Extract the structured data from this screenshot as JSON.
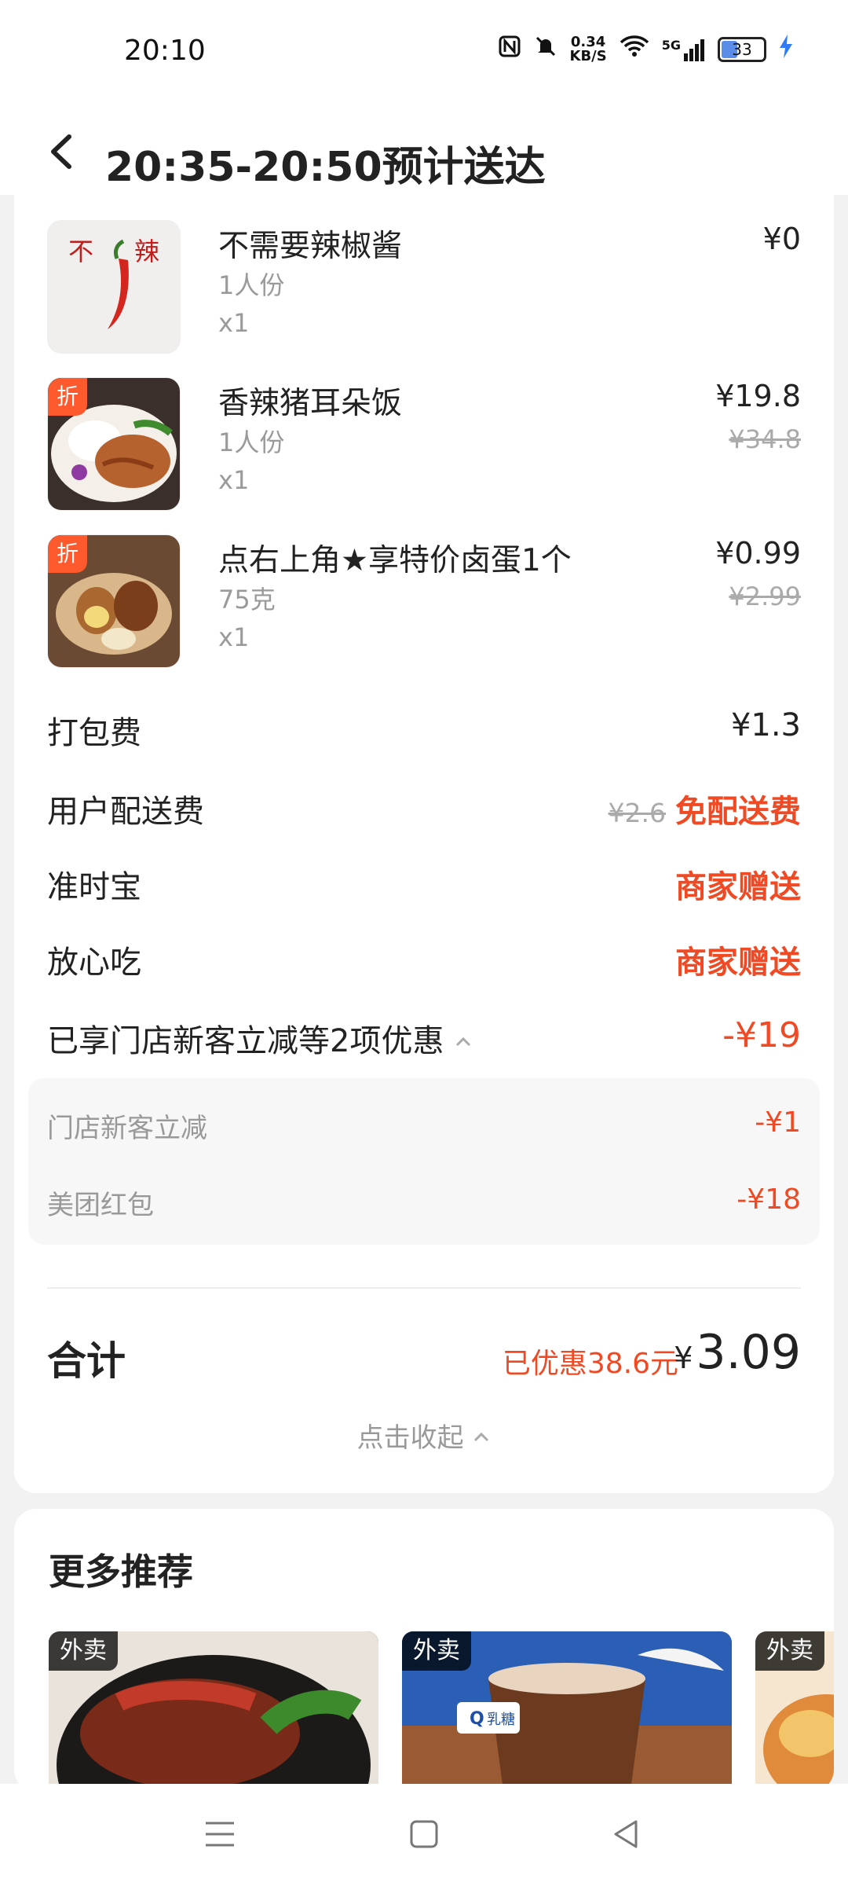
{
  "status": {
    "time": "20:10",
    "net_speed_value": "0.34",
    "net_speed_unit": "KB/S",
    "network": "5G",
    "battery": "33"
  },
  "header": {
    "title": "20:35-20:50预计送达"
  },
  "items": [
    {
      "name": "不需要辣椒酱",
      "spec": "1人份",
      "qty": "x1",
      "price": "¥0",
      "original_price": "",
      "discount_tag": "",
      "thumb_text": "不 辣"
    },
    {
      "name": "香辣猪耳朵饭",
      "spec": "1人份",
      "qty": "x1",
      "price": "¥19.8",
      "original_price": "¥34.8",
      "discount_tag": "折"
    },
    {
      "name": "点右上角★享特价卤蛋1个",
      "spec": "75克",
      "qty": "x1",
      "price": "¥0.99",
      "original_price": "¥2.99",
      "discount_tag": "折"
    }
  ],
  "fees": {
    "packing": {
      "label": "打包费",
      "value": "¥1.3"
    },
    "delivery": {
      "label": "用户配送费",
      "original": "¥2.6",
      "value": "免配送费"
    },
    "ontime": {
      "label": "准时宝",
      "value": "商家赠送"
    },
    "safe_eat": {
      "label": "放心吃",
      "value": "商家赠送"
    }
  },
  "discount": {
    "summary_label": "已享门店新客立减等2项优惠",
    "summary_value": "-¥19",
    "rows": [
      {
        "label": "门店新客立减",
        "value": "-¥1"
      },
      {
        "label": "美团红包",
        "value": "-¥18"
      }
    ]
  },
  "total": {
    "label": "合计",
    "saved": "已优惠38.6元",
    "currency": "¥",
    "amount": "3.09",
    "collapse": "点击收起"
  },
  "recommend": {
    "title": "更多推荐",
    "tags": [
      "外卖",
      "外卖",
      "外卖"
    ],
    "brand_text": "乳糖"
  },
  "colors": {
    "accent": "#f04a24",
    "discount_tag": "#ff5a2e"
  }
}
